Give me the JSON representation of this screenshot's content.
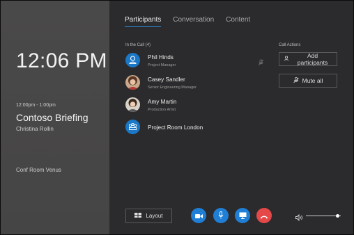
{
  "left": {
    "clock": "12:06 PM",
    "meeting_time": "12:00pm - 1:00pm",
    "meeting_title": "Contoso Briefing",
    "organizer": "Christina Rollin",
    "room": "Conf Room Venus"
  },
  "tabs": [
    {
      "label": "Participants",
      "active": true
    },
    {
      "label": "Conversation",
      "active": false
    },
    {
      "label": "Content",
      "active": false
    }
  ],
  "in_call_label": "In the Call (4)",
  "participants": [
    {
      "name": "Phil Hinds",
      "title": "Project Manager",
      "avatar": "person-icon",
      "muted": true
    },
    {
      "name": "Casey Sandler",
      "title": "Senior Engineering Manager",
      "avatar": "photo",
      "muted": false
    },
    {
      "name": "Amy Martin",
      "title": "Production Artist",
      "avatar": "photo",
      "muted": false
    },
    {
      "name": "Project Room London",
      "title": "",
      "avatar": "room-icon",
      "muted": false
    }
  ],
  "call_actions": {
    "label": "Call Actions",
    "add_participants": "Add participants",
    "mute_all": "Mute all"
  },
  "controls": {
    "layout_label": "Layout",
    "volume_level": 0.9,
    "colors": {
      "accent": "#1f7fd6",
      "hangup": "#e54848"
    }
  }
}
